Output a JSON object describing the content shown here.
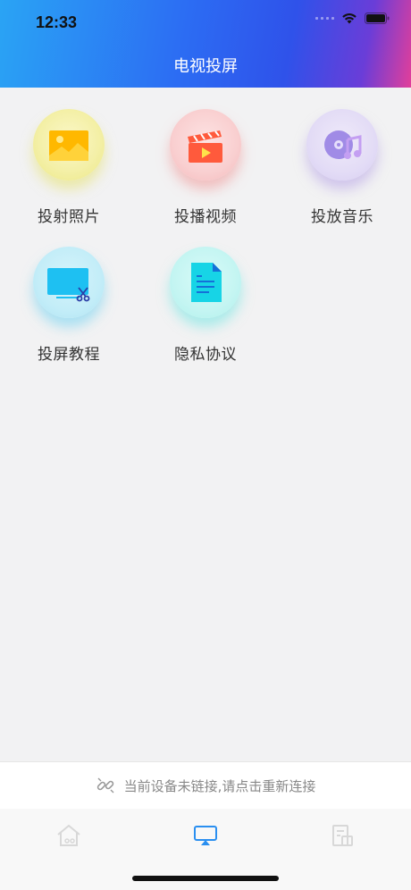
{
  "status": {
    "time": "12:33"
  },
  "header": {
    "title": "电视投屏"
  },
  "features": [
    {
      "label": "投射照片",
      "icon": "photo-icon"
    },
    {
      "label": "投播视频",
      "icon": "video-clapper-icon"
    },
    {
      "label": "投放音乐",
      "icon": "music-disc-icon"
    },
    {
      "label": "投屏教程",
      "icon": "screen-tutorial-icon"
    },
    {
      "label": "隐私协议",
      "icon": "document-icon"
    }
  ],
  "connection": {
    "message": "当前设备未链接,请点击重新连接",
    "icon": "link-icon"
  },
  "tabs": [
    {
      "name": "home",
      "icon": "home-icon"
    },
    {
      "name": "cast",
      "icon": "cast-icon",
      "active": true
    },
    {
      "name": "files",
      "icon": "files-icon"
    }
  ],
  "colors": {
    "header_start": "#2aa4f4",
    "header_end": "#e23e9a",
    "active_tab": "#2a8ff0"
  }
}
